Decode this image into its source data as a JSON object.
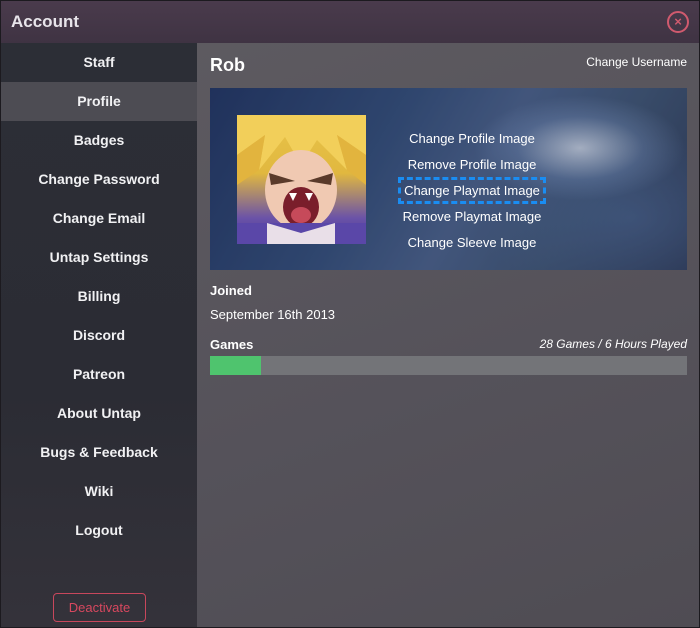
{
  "window": {
    "title": "Account",
    "close_symbol": "×"
  },
  "sidebar": {
    "items": [
      {
        "label": "Staff",
        "active": false
      },
      {
        "label": "Profile",
        "active": true
      },
      {
        "label": "Badges",
        "active": false
      },
      {
        "label": "Change Password",
        "active": false
      },
      {
        "label": "Change Email",
        "active": false
      },
      {
        "label": "Untap Settings",
        "active": false
      },
      {
        "label": "Billing",
        "active": false
      },
      {
        "label": "Discord",
        "active": false
      },
      {
        "label": "Patreon",
        "active": false
      },
      {
        "label": "About Untap",
        "active": false
      },
      {
        "label": "Bugs & Feedback",
        "active": false
      },
      {
        "label": "Wiki",
        "active": false
      },
      {
        "label": "Logout",
        "active": false
      }
    ],
    "deactivate_label": "Deactivate"
  },
  "profile": {
    "username": "Rob",
    "change_username_label": "Change Username",
    "image_actions": [
      "Change Profile Image",
      "Remove Profile Image",
      "Change Playmat Image",
      "Remove Playmat Image",
      "Change Sleeve Image"
    ],
    "focused_action": "Change Playmat Image",
    "joined_label": "Joined",
    "joined_date": "September 16th 2013",
    "games_label": "Games",
    "games_summary": "28 Games / 6 Hours Played",
    "games_progress_fraction": 0.107
  },
  "colors": {
    "accent_danger": "#d05a6e",
    "progress_fill": "#4fc46e",
    "focus_outline": "#1a8df2"
  }
}
